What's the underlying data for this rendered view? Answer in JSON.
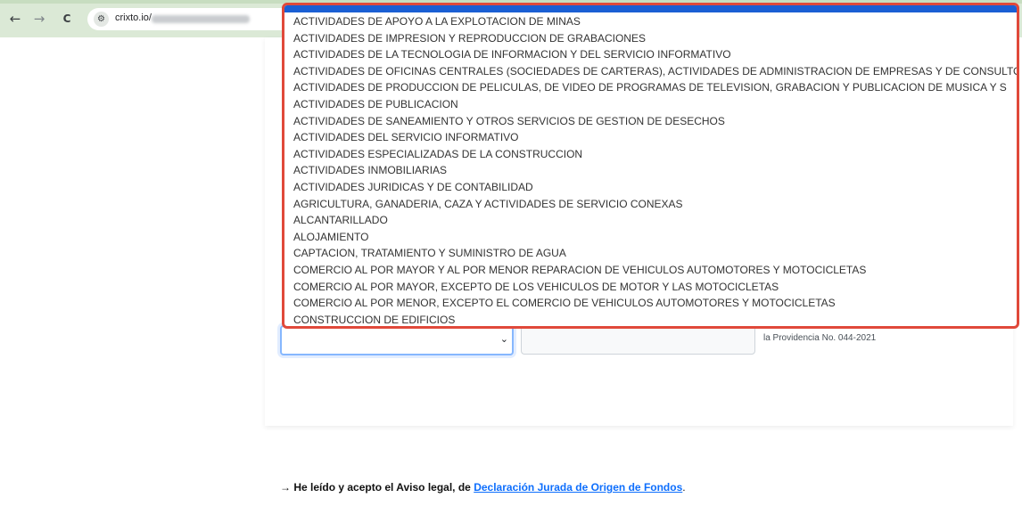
{
  "browser": {
    "back_glyph": "←",
    "forward_glyph": "→",
    "reload_glyph": "C",
    "url_domain": "crixto.io/",
    "site_icon": "tune-icon"
  },
  "form": {
    "side_note": "la Providencia No. 044-2021"
  },
  "dropdown": {
    "options": [
      "ACTIVIDADES DE APOYO A LA EXPLOTACION DE MINAS",
      "ACTIVIDADES DE IMPRESION Y REPRODUCCION DE GRABACIONES",
      "ACTIVIDADES DE LA TECNOLOGIA DE INFORMACION Y DEL SERVICIO INFORMATIVO",
      "ACTIVIDADES DE OFICINAS CENTRALES (SOCIEDADES DE CARTERAS), ACTIVIDADES DE ADMINISTRACION DE EMPRESAS Y DE CONSULTO",
      "ACTIVIDADES DE PRODUCCION DE PELICULAS, DE VIDEO DE PROGRAMAS DE TELEVISION, GRABACION Y PUBLICACION DE MUSICA Y S",
      "ACTIVIDADES DE PUBLICACION",
      "ACTIVIDADES DE SANEAMIENTO Y OTROS SERVICIOS DE GESTION DE DESECHOS",
      "ACTIVIDADES DEL SERVICIO INFORMATIVO",
      "ACTIVIDADES ESPECIALIZADAS DE LA CONSTRUCCION",
      "ACTIVIDADES INMOBILIARIAS",
      "ACTIVIDADES JURIDICAS Y DE CONTABILIDAD",
      "AGRICULTURA, GANADERIA, CAZA Y ACTIVIDADES DE SERVICIO CONEXAS",
      "ALCANTARILLADO",
      "ALOJAMIENTO",
      "CAPTACION, TRATAMIENTO Y SUMINISTRO DE AGUA",
      "COMERCIO AL POR MAYOR Y AL POR MENOR REPARACION DE VEHICULOS AUTOMOTORES Y MOTOCICLETAS",
      "COMERCIO AL POR MAYOR, EXCEPTO DE LOS VEHICULOS DE MOTOR Y LAS MOTOCICLETAS",
      "COMERCIO AL POR MENOR, EXCEPTO EL COMERCIO DE VEHICULOS AUTOMOTORES Y MOTOCICLETAS",
      "CONSTRUCCION DE EDIFICIOS"
    ]
  },
  "footer": {
    "arrow": "→",
    "agree_text": "He leído y acepto el Aviso legal, de",
    "link_text": "Declaración Jurada de Origen de Fondos",
    "end": "."
  },
  "colors": {
    "highlight_border": "#e0493a",
    "dropdown_top": "#1a5fd4",
    "link": "#0d6efd"
  }
}
